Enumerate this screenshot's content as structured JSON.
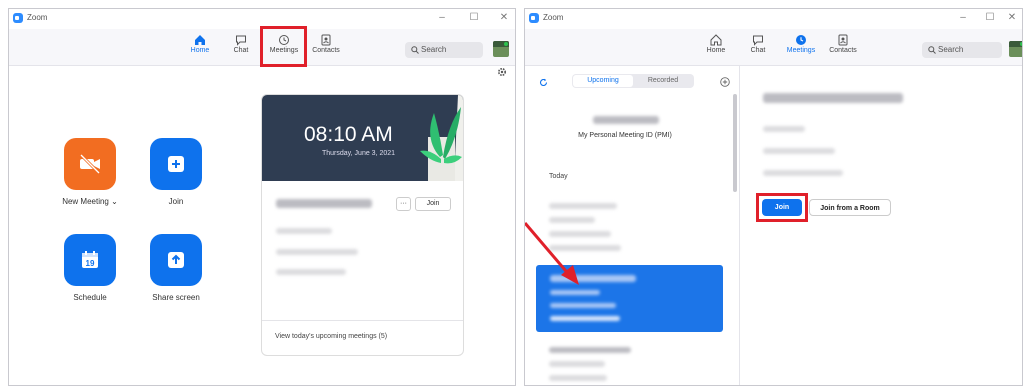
{
  "left_window": {
    "app_title": "Zoom",
    "nav": [
      {
        "label": "Home",
        "icon": "home-icon"
      },
      {
        "label": "Chat",
        "icon": "chat-icon"
      },
      {
        "label": "Meetings",
        "icon": "clock-icon"
      },
      {
        "label": "Contacts",
        "icon": "contacts-icon"
      }
    ],
    "active_tab": "Home",
    "search_placeholder": "Search",
    "actions": [
      {
        "label": "New Meeting",
        "icon": "video-off-icon",
        "color": "#f26d21"
      },
      {
        "label": "Join",
        "icon": "plus-icon",
        "color": "#0e72ed"
      },
      {
        "label": "Schedule",
        "icon": "calendar-icon",
        "color": "#0e72ed"
      },
      {
        "label": "Share screen",
        "icon": "share-up-arrow-icon",
        "color": "#0e72ed"
      }
    ],
    "calendar_day": "19",
    "new_meeting_dropdown": "⌄",
    "card": {
      "time": "08:10 AM",
      "date": "Thursday, June 3, 2021",
      "more_label": "···",
      "join_label": "Join",
      "footer": "View today's upcoming meetings (5)"
    }
  },
  "right_window": {
    "app_title": "Zoom",
    "nav": [
      {
        "label": "Home",
        "icon": "home-icon"
      },
      {
        "label": "Chat",
        "icon": "chat-icon"
      },
      {
        "label": "Meetings",
        "icon": "clock-icon"
      },
      {
        "label": "Contacts",
        "icon": "contacts-icon"
      }
    ],
    "active_tab": "Meetings",
    "search_placeholder": "Search",
    "tabs": {
      "upcoming": "Upcoming",
      "recorded": "Recorded"
    },
    "pmi_label": "My Personal Meeting ID (PMI)",
    "today_label": "Today",
    "join_label": "Join",
    "join_room_label": "Join from a Room"
  },
  "colors": {
    "accent": "#0e72ed",
    "highlight": "#e0202a",
    "orange": "#f26d21"
  }
}
